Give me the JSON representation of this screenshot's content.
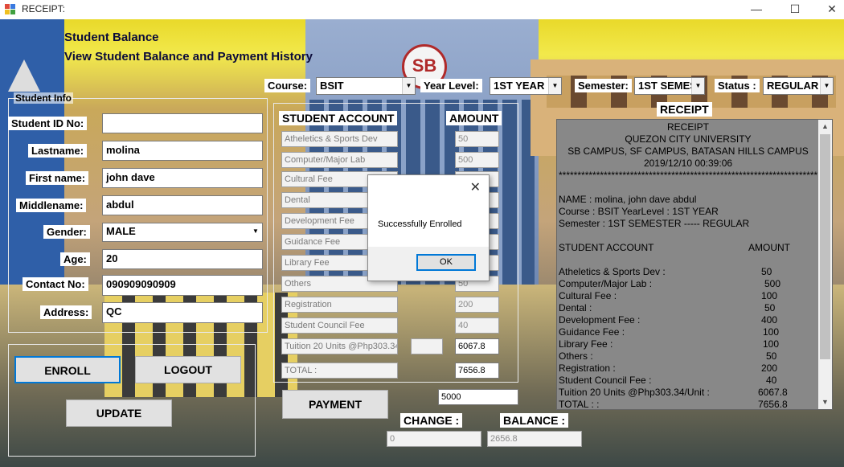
{
  "window": {
    "title": "RECEIPT:",
    "min": "—",
    "max": "☐",
    "close": "✕"
  },
  "header": {
    "title": "Student Balance",
    "subtitle": "View Student Balance and Payment History"
  },
  "filters": {
    "course_label": "Course:",
    "course_value": "BSIT",
    "year_label": "Year Level:",
    "year_value": "1ST YEAR",
    "semester_label": "Semester:",
    "semester_value": "1ST SEMES",
    "status_label": "Status :",
    "status_value": "REGULAR"
  },
  "student_info": {
    "group_title": "Student Info",
    "fields": [
      {
        "label": "Student ID No:",
        "value": ""
      },
      {
        "label": "Lastname:",
        "value": "molina"
      },
      {
        "label": "First name:",
        "value": "john dave"
      },
      {
        "label": "Middlename:",
        "value": "abdul"
      },
      {
        "label": "Gender:",
        "value": "MALE"
      },
      {
        "label": "Age:",
        "value": "20"
      },
      {
        "label": "Contact No:",
        "value": "090909090909"
      },
      {
        "label": "Address:",
        "value": "QC"
      }
    ]
  },
  "buttons": {
    "enroll": "ENROLL",
    "logout": "LOGOUT",
    "update": "UPDATE",
    "payment": "PAYMENT"
  },
  "account": {
    "header_left": "STUDENT ACCOUNT",
    "header_right": "AMOUNT",
    "fees": [
      {
        "name": "Atheletics & Sports Dev",
        "amount": "50"
      },
      {
        "name": "Computer/Major Lab",
        "amount": "500"
      },
      {
        "name": "Cultural Fee",
        "amount": ""
      },
      {
        "name": "Dental",
        "amount": ""
      },
      {
        "name": "Development Fee",
        "amount": ""
      },
      {
        "name": "Guidance Fee",
        "amount": ""
      },
      {
        "name": "Library Fee",
        "amount": ""
      },
      {
        "name": "Others",
        "amount": "50"
      },
      {
        "name": "Registration",
        "amount": "200"
      },
      {
        "name": "Student Council Fee",
        "amount": "40"
      }
    ],
    "tuition_label": "Tuition 20 Units @Php303.34",
    "tuition_units": "",
    "tuition_amount": "6067.8",
    "total_label": "TOTAL :",
    "total_amount": "7656.8",
    "payment_value": "5000",
    "change_label": "CHANGE :",
    "change_value": "0",
    "balance_label": "BALANCE :",
    "balance_value": "2656.8"
  },
  "receipt": {
    "label": "RECEIPT",
    "head": [
      "RECEIPT",
      "QUEZON CITY UNIVERSITY",
      "SB CAMPUS, SF CAMPUS, BATASAN HILLS CAMPUS",
      "2019/12/10 00:39:06"
    ],
    "stars": "**********************************************************************",
    "name_line": "NAME :    molina,  john dave  abdul",
    "course_line": "Course : BSIT   YearLevel : 1ST YEAR",
    "sem_line": "Semester : 1ST SEMESTER   -----  REGULAR",
    "col_left": "STUDENT ACCOUNT",
    "col_right": "AMOUNT",
    "items": [
      {
        "name": "Atheletics & Sports Dev  :",
        "amount": "50"
      },
      {
        "name": "Computer/Major Lab  :",
        "amount": "500"
      },
      {
        "name": "Cultural Fee  :",
        "amount": "100"
      },
      {
        "name": "Dental  :",
        "amount": "50"
      },
      {
        "name": "Development Fee  :",
        "amount": "400"
      },
      {
        "name": "Guidance Fee  :",
        "amount": "100"
      },
      {
        "name": "Library Fee  :",
        "amount": "100"
      },
      {
        "name": "Others  :",
        "amount": "50"
      },
      {
        "name": "Registration  :",
        "amount": "200"
      },
      {
        "name": "Student Council Fee  :",
        "amount": "40"
      },
      {
        "name": "Tuition 20 Units @Php303.34/Unit  :",
        "amount": "6067.8"
      },
      {
        "name": "TOTAL : :",
        "amount": "7656.8"
      }
    ]
  },
  "dialog": {
    "message": "Successfully Enrolled",
    "ok": "OK",
    "close": "✕"
  },
  "logo": {
    "text": "SB"
  }
}
